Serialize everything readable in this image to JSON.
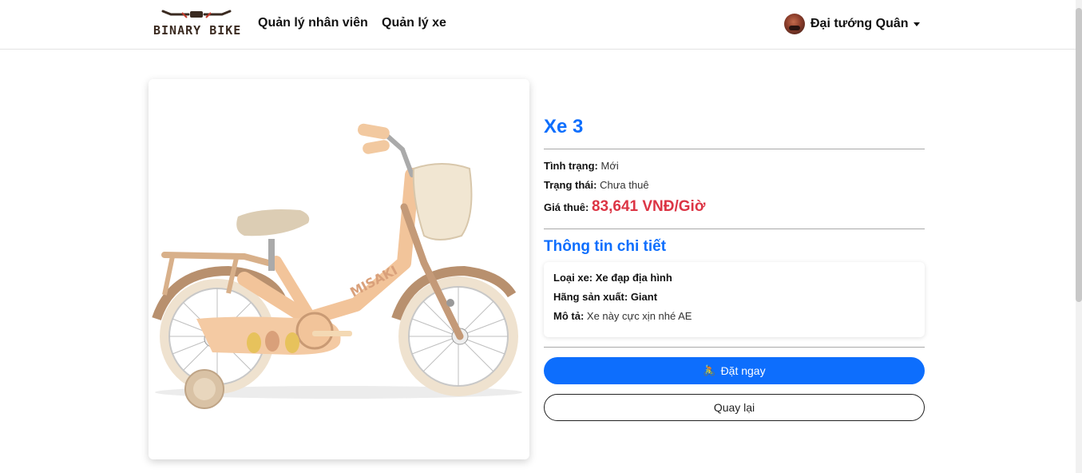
{
  "navbar": {
    "brand": "BINARY BIKE",
    "links": [
      "Quản lý nhân viên",
      "Quản lý xe"
    ],
    "user_name": "Đại tướng Quân"
  },
  "product": {
    "title": "Xe 3",
    "condition_label": "Tình trạng:",
    "condition_value": "Mới",
    "status_label": "Trạng thái:",
    "status_value": "Chưa thuê",
    "price_label": "Giá thuê:",
    "price_value": "83,641 VNĐ/Giờ",
    "frame_text": "MISAKI"
  },
  "details": {
    "heading": "Thông tin chi tiết",
    "type_label": "Loại xe:",
    "type_value": "Xe đạp địa hình",
    "brand_label": "Hãng sản xuất:",
    "brand_value": "Giant",
    "desc_label": "Mô tả:",
    "desc_value": "Xe này cực xịn nhé AE"
  },
  "actions": {
    "book_icon": "🚴",
    "book_label": "Đặt ngay",
    "back_label": "Quay lại"
  },
  "colors": {
    "primary": "#0d6efd",
    "price": "#dc3545"
  }
}
